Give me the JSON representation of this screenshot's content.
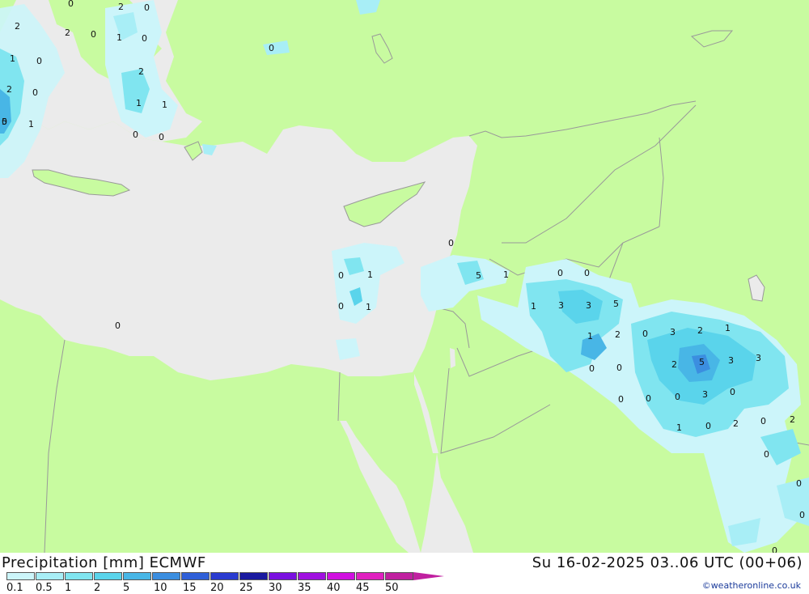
{
  "header": {
    "title": "Precipitation [mm] ECMWF",
    "datetime": "Su 16-02-2025 03..06 UTC (00+06)"
  },
  "legend": {
    "labels": [
      "0.1",
      "0.5",
      "1",
      "2",
      "5",
      "10",
      "15",
      "20",
      "25",
      "30",
      "35",
      "40",
      "45",
      "50"
    ],
    "colors": [
      "#ccf5fa",
      "#a8eef6",
      "#80e5f0",
      "#5ad4eb",
      "#48b6e6",
      "#3b8ee0",
      "#2f5fd8",
      "#2a3bd0",
      "#1a1aa0",
      "#7a10e0",
      "#a010e0",
      "#d010e0",
      "#e020c0",
      "#c020a0"
    ]
  },
  "credit": "©weatheronline.co.uk",
  "map": {
    "colors": {
      "land": "#c8fba0",
      "sea": "#ebebeb",
      "border": "#999999"
    },
    "labels": [
      {
        "t": "0"
      },
      {
        "t": "2"
      },
      {
        "t": "0"
      },
      {
        "t": "2"
      },
      {
        "t": "2"
      },
      {
        "t": "0"
      },
      {
        "t": "1"
      },
      {
        "t": "0"
      },
      {
        "t": "1"
      },
      {
        "t": "0"
      },
      {
        "t": "2"
      },
      {
        "t": "0"
      },
      {
        "t": "0"
      },
      {
        "t": "2"
      },
      {
        "t": "0"
      },
      {
        "t": "1"
      },
      {
        "t": "1"
      },
      {
        "t": "5"
      },
      {
        "t": "1"
      },
      {
        "t": "0"
      },
      {
        "t": "0"
      },
      {
        "t": "0"
      },
      {
        "t": "0"
      },
      {
        "t": "1"
      },
      {
        "t": "0"
      },
      {
        "t": "1"
      },
      {
        "t": "0"
      },
      {
        "t": "5"
      },
      {
        "t": "1"
      },
      {
        "t": "0"
      },
      {
        "t": "0"
      },
      {
        "t": "1"
      },
      {
        "t": "3"
      },
      {
        "t": "3"
      },
      {
        "t": "5"
      },
      {
        "t": "1"
      },
      {
        "t": "2"
      },
      {
        "t": "0"
      },
      {
        "t": "3"
      },
      {
        "t": "2"
      },
      {
        "t": "1"
      },
      {
        "t": "0"
      },
      {
        "t": "0"
      },
      {
        "t": "2"
      },
      {
        "t": "5"
      },
      {
        "t": "3"
      },
      {
        "t": "3"
      },
      {
        "t": "0"
      },
      {
        "t": "0"
      },
      {
        "t": "0"
      },
      {
        "t": "3"
      },
      {
        "t": "0"
      },
      {
        "t": "1"
      },
      {
        "t": "0"
      },
      {
        "t": "2"
      },
      {
        "t": "0"
      },
      {
        "t": "2"
      },
      {
        "t": "0"
      },
      {
        "t": "0"
      },
      {
        "t": "0"
      },
      {
        "t": "0"
      }
    ]
  }
}
